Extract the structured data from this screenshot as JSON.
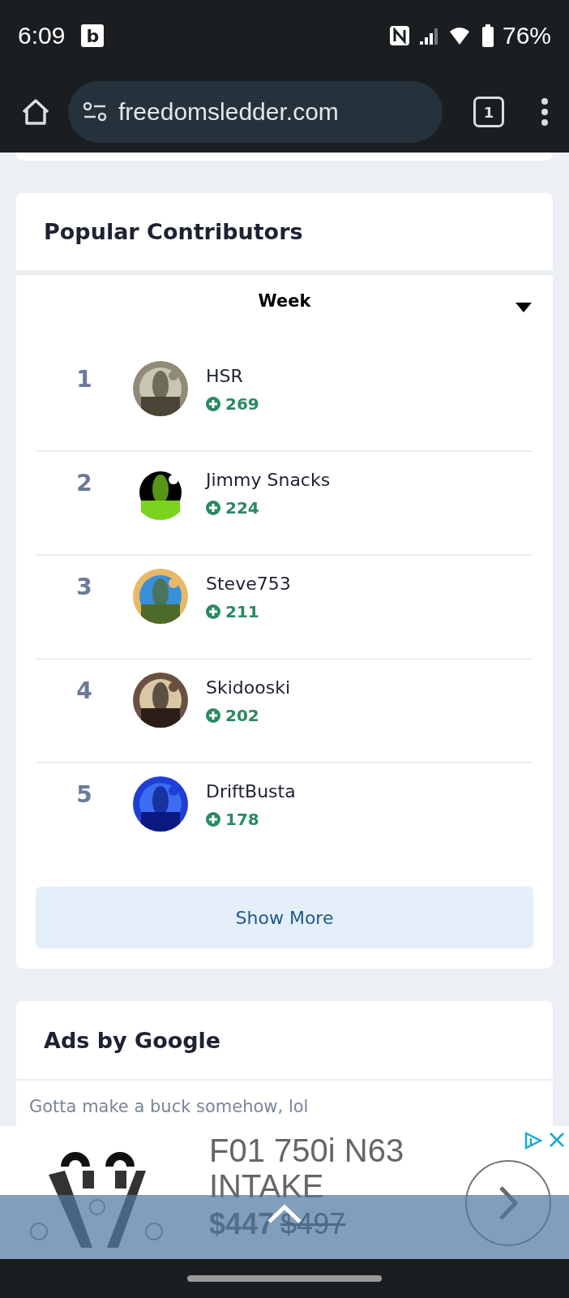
{
  "status_bar": {
    "time": "6:09",
    "notification_letter": "b",
    "battery": "76%"
  },
  "browser": {
    "url": "freedomsledder.com",
    "tab_count": "1"
  },
  "contributors": {
    "title": "Popular Contributors",
    "period": "Week",
    "rows": [
      {
        "rank": "1",
        "name": "HSR",
        "score": "269"
      },
      {
        "rank": "2",
        "name": "Jimmy Snacks",
        "score": "224"
      },
      {
        "rank": "3",
        "name": "Steve753",
        "score": "211"
      },
      {
        "rank": "4",
        "name": "Skidooski",
        "score": "202"
      },
      {
        "rank": "5",
        "name": "DriftBusta",
        "score": "178"
      }
    ],
    "show_more": "Show More"
  },
  "ads": {
    "title": "Ads by Google",
    "note": "Gotta make a buck somehow, lol"
  },
  "ad_banner": {
    "title": "F01 750i N63 INTAKE",
    "price": "$447",
    "old_price": "$497"
  }
}
